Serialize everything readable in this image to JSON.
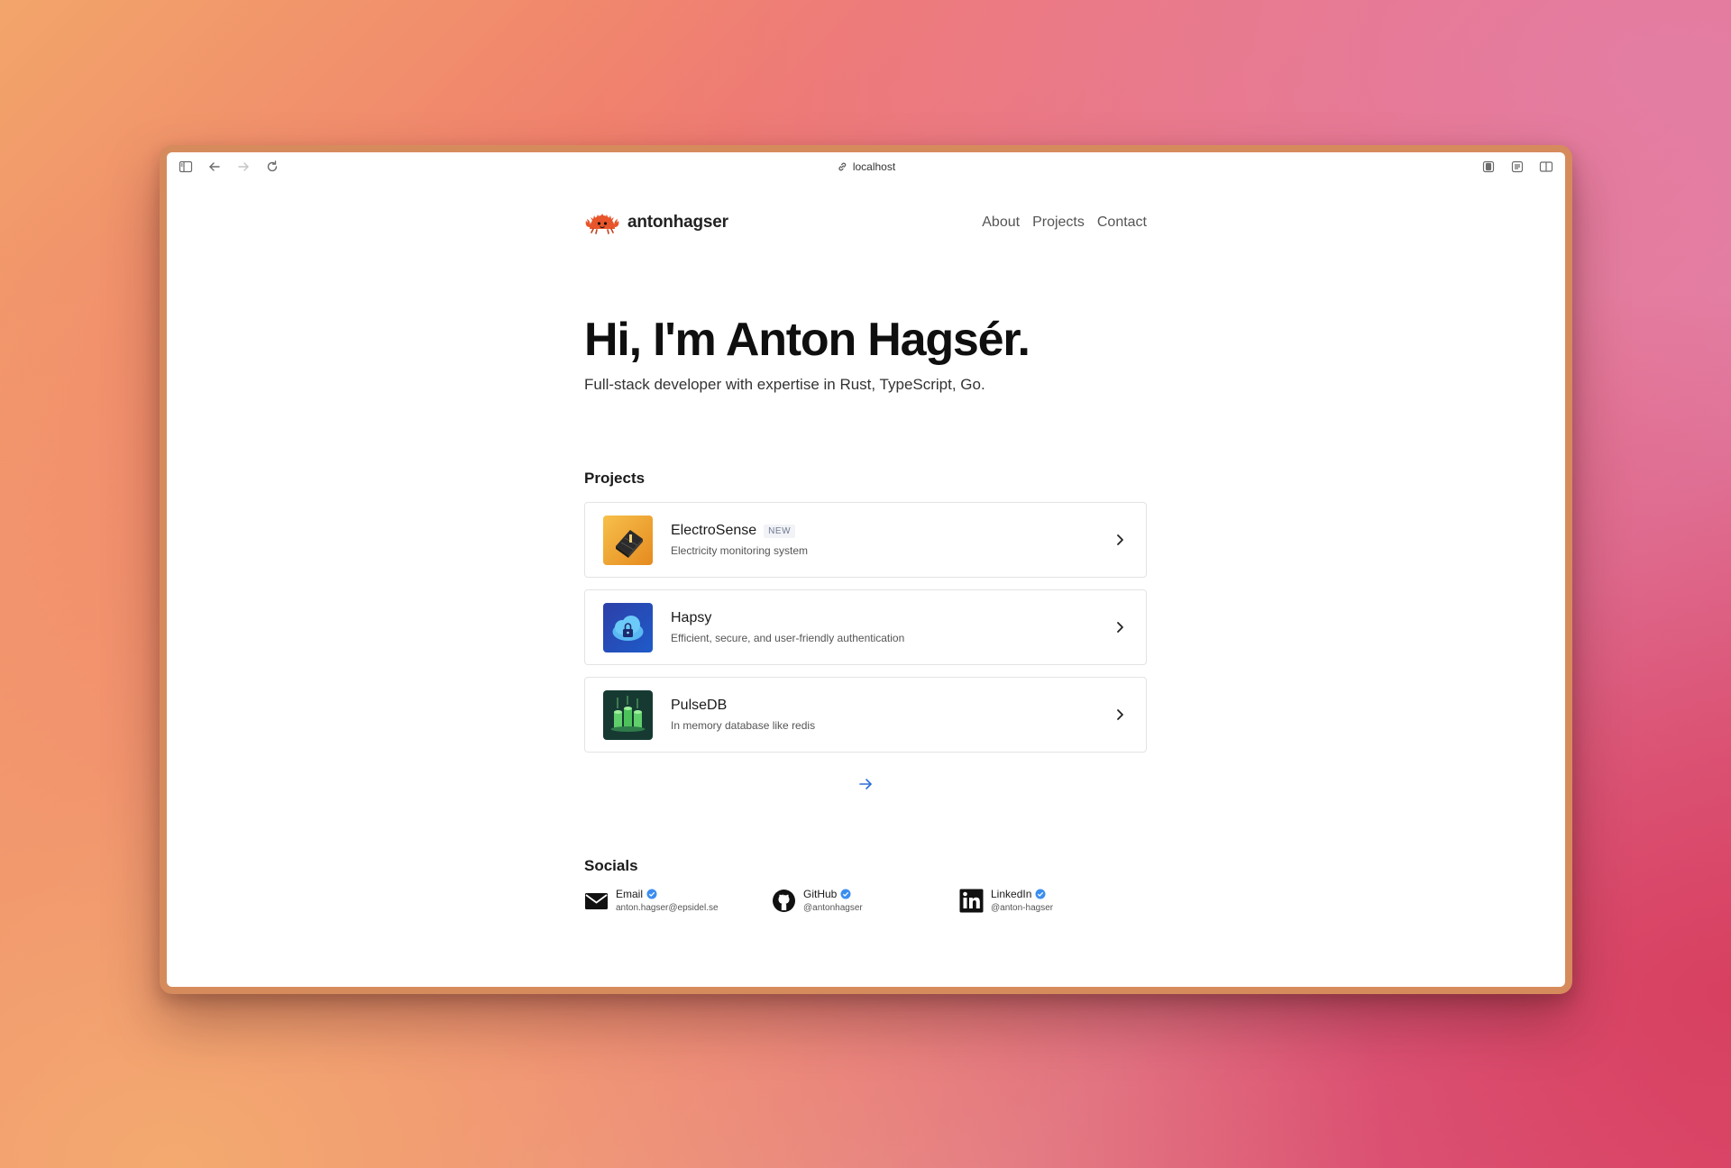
{
  "browser": {
    "address": "localhost"
  },
  "site": {
    "brand": "antonhagser",
    "nav": [
      {
        "label": "About"
      },
      {
        "label": "Projects"
      },
      {
        "label": "Contact"
      }
    ]
  },
  "hero": {
    "title": "Hi, I'm Anton Hagsér.",
    "subtitle": "Full-stack developer with expertise in Rust, TypeScript, Go."
  },
  "projects": {
    "heading": "Projects",
    "items": [
      {
        "name": "ElectroSense",
        "badge": "NEW",
        "description": "Electricity monitoring system"
      },
      {
        "name": "Hapsy",
        "description": "Efficient, secure, and user-friendly authentication"
      },
      {
        "name": "PulseDB",
        "description": "In memory database like redis"
      }
    ]
  },
  "socials": {
    "heading": "Socials",
    "items": [
      {
        "name": "Email",
        "handle": "anton.hagser@epsidel.se",
        "icon": "mail-icon"
      },
      {
        "name": "GitHub",
        "handle": "@antonhagser",
        "icon": "github-icon"
      },
      {
        "name": "LinkedIn",
        "handle": "@anton-hagser",
        "icon": "linkedin-icon"
      }
    ]
  },
  "colors": {
    "accent": "#2f6fd8",
    "verified": "#3b8ef0",
    "frame": "#d68b5c"
  }
}
